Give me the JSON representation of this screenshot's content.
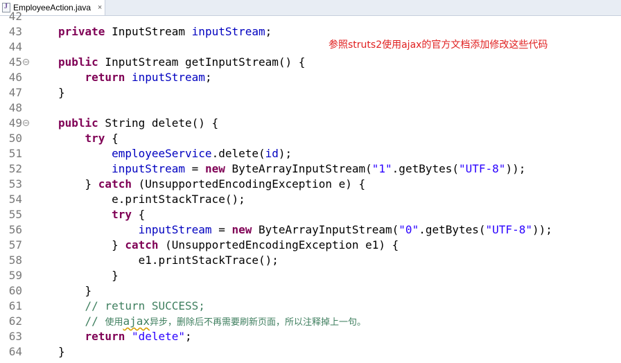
{
  "tab": {
    "title": "EmployeeAction.java",
    "close_icon": "×",
    "file_icon": "java-file-icon"
  },
  "annotation": "参照struts2使用ajax的官方文档添加修改这些代码",
  "lines": [
    {
      "n": "42",
      "partial": true,
      "tokens": []
    },
    {
      "n": "43",
      "tokens": [
        {
          "t": "private",
          "c": "kw"
        },
        {
          "t": " InputStream "
        },
        {
          "t": "inputStream",
          "c": "fld"
        },
        {
          "t": ";"
        }
      ]
    },
    {
      "n": "44",
      "tokens": []
    },
    {
      "n": "45",
      "fold": true,
      "tokens": [
        {
          "t": "public",
          "c": "kw"
        },
        {
          "t": " InputStream getInputStream() {"
        }
      ]
    },
    {
      "n": "46",
      "tokens": [
        {
          "t": "    "
        },
        {
          "t": "return",
          "c": "kw"
        },
        {
          "t": " "
        },
        {
          "t": "inputStream",
          "c": "fld"
        },
        {
          "t": ";"
        }
      ]
    },
    {
      "n": "47",
      "tokens": [
        {
          "t": "}"
        }
      ]
    },
    {
      "n": "48",
      "tokens": []
    },
    {
      "n": "49",
      "fold": true,
      "tokens": [
        {
          "t": "public",
          "c": "kw"
        },
        {
          "t": " String delete() {"
        }
      ]
    },
    {
      "n": "50",
      "tokens": [
        {
          "t": "    "
        },
        {
          "t": "try",
          "c": "kw"
        },
        {
          "t": " {"
        }
      ]
    },
    {
      "n": "51",
      "tokens": [
        {
          "t": "        "
        },
        {
          "t": "employeeService",
          "c": "fld"
        },
        {
          "t": ".delete("
        },
        {
          "t": "id",
          "c": "fld"
        },
        {
          "t": ");"
        }
      ]
    },
    {
      "n": "52",
      "tokens": [
        {
          "t": "        "
        },
        {
          "t": "inputStream",
          "c": "fld"
        },
        {
          "t": " = "
        },
        {
          "t": "new",
          "c": "kw"
        },
        {
          "t": " ByteArrayInputStream("
        },
        {
          "t": "\"1\"",
          "c": "str"
        },
        {
          "t": ".getBytes("
        },
        {
          "t": "\"UTF-8\"",
          "c": "str"
        },
        {
          "t": "));"
        }
      ]
    },
    {
      "n": "53",
      "tokens": [
        {
          "t": "    } "
        },
        {
          "t": "catch",
          "c": "kw"
        },
        {
          "t": " (UnsupportedEncodingException e) {"
        }
      ]
    },
    {
      "n": "54",
      "tokens": [
        {
          "t": "        e.printStackTrace();"
        }
      ]
    },
    {
      "n": "55",
      "tokens": [
        {
          "t": "        "
        },
        {
          "t": "try",
          "c": "kw"
        },
        {
          "t": " {"
        }
      ]
    },
    {
      "n": "56",
      "tokens": [
        {
          "t": "            "
        },
        {
          "t": "inputStream",
          "c": "fld"
        },
        {
          "t": " = "
        },
        {
          "t": "new",
          "c": "kw"
        },
        {
          "t": " ByteArrayInputStream("
        },
        {
          "t": "\"0\"",
          "c": "str"
        },
        {
          "t": ".getBytes("
        },
        {
          "t": "\"UTF-8\"",
          "c": "str"
        },
        {
          "t": "));"
        }
      ]
    },
    {
      "n": "57",
      "tokens": [
        {
          "t": "        } "
        },
        {
          "t": "catch",
          "c": "kw"
        },
        {
          "t": " (UnsupportedEncodingException e1) {"
        }
      ]
    },
    {
      "n": "58",
      "tokens": [
        {
          "t": "            e1.printStackTrace();"
        }
      ]
    },
    {
      "n": "59",
      "tokens": [
        {
          "t": "        }"
        }
      ]
    },
    {
      "n": "60",
      "tokens": [
        {
          "t": "    }"
        }
      ]
    },
    {
      "n": "61",
      "tokens": [
        {
          "t": "    "
        },
        {
          "t": "// return SUCCESS;",
          "c": "com"
        }
      ]
    },
    {
      "n": "62",
      "tokens": [
        {
          "t": "    "
        },
        {
          "t": "// ",
          "c": "com"
        },
        {
          "t": "使用",
          "c": "com cjk"
        },
        {
          "t": "ajax",
          "c": "com squig"
        },
        {
          "t": "异步，删除后不再需要刷新页面，所以注释掉上一句。",
          "c": "com cjk"
        }
      ]
    },
    {
      "n": "63",
      "tokens": [
        {
          "t": "    "
        },
        {
          "t": "return",
          "c": "kw"
        },
        {
          "t": " "
        },
        {
          "t": "\"delete\"",
          "c": "str"
        },
        {
          "t": ";"
        }
      ]
    },
    {
      "n": "64",
      "tokens": [
        {
          "t": "}"
        }
      ]
    }
  ]
}
